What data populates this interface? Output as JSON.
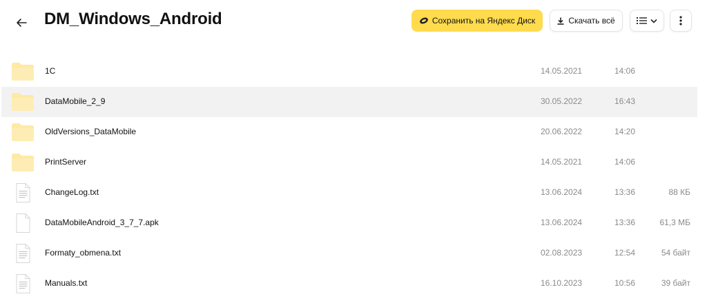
{
  "header": {
    "back_icon": "arrow-left-icon",
    "title": "DM_Windows_Android",
    "save_label": "Сохранить на Яндекс Диск",
    "save_icon": "yandex-disk-icon",
    "download_label": "Скачать всё",
    "download_icon": "download-icon",
    "view_icon": "list-view-icon",
    "more_icon": "more-vertical-icon"
  },
  "colors": {
    "accent_yellow": "#ffdb4d",
    "folder_yellow": "#ffeaa0",
    "row_hover": "#f2f2f2",
    "meta_text": "#8a8a8a"
  },
  "files": [
    {
      "name": "1С",
      "type": "folder",
      "date": "14.05.2021",
      "time": "14:06",
      "size": ""
    },
    {
      "name": "DataMobile_2_9",
      "type": "folder",
      "date": "30.05.2022",
      "time": "16:43",
      "size": ""
    },
    {
      "name": "OldVersions_DataMobile",
      "type": "folder",
      "date": "20.06.2022",
      "time": "14:20",
      "size": ""
    },
    {
      "name": "PrintServer",
      "type": "folder",
      "date": "14.05.2021",
      "time": "14:06",
      "size": ""
    },
    {
      "name": "ChangeLog.txt",
      "type": "text",
      "date": "13.06.2024",
      "time": "13:36",
      "size": "88 КБ"
    },
    {
      "name": "DataMobileAndroid_3_7_7.apk",
      "type": "file",
      "date": "13.06.2024",
      "time": "13:36",
      "size": "61,3 МБ"
    },
    {
      "name": "Formaty_obmena.txt",
      "type": "text",
      "date": "02.08.2023",
      "time": "12:54",
      "size": "54 байт"
    },
    {
      "name": "Manuals.txt",
      "type": "text",
      "date": "16.10.2023",
      "time": "10:56",
      "size": "39 байт"
    }
  ]
}
